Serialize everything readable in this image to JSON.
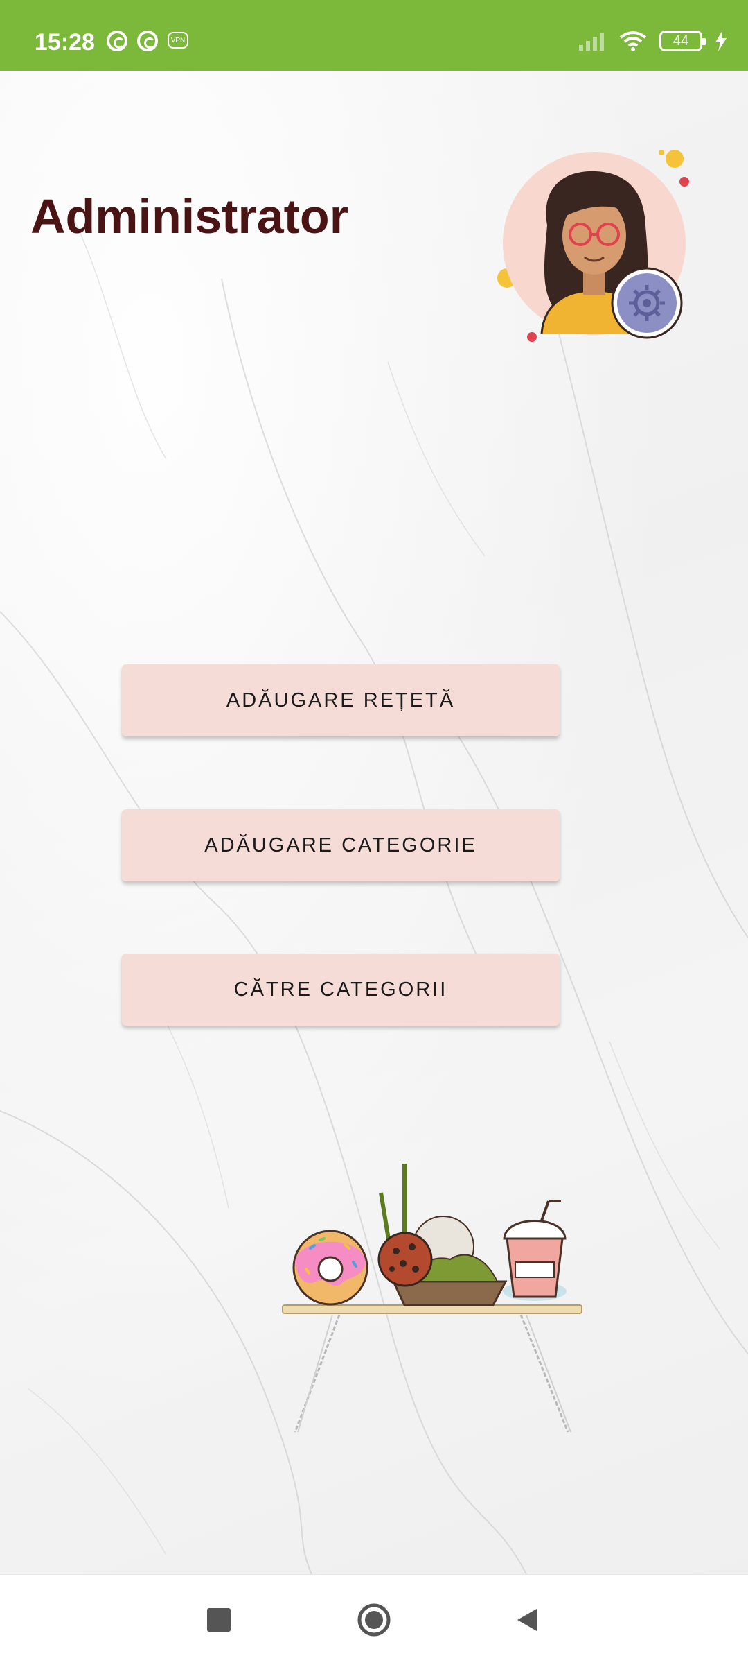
{
  "status_bar": {
    "time": "15:28",
    "battery_level": "44",
    "icons": [
      "sync-icon",
      "sync-icon",
      "vpn-badge-icon",
      "signal-icon",
      "wifi-icon",
      "battery-icon",
      "charging-icon"
    ],
    "background_color": "#7cb83a"
  },
  "header": {
    "title": "Administrator",
    "avatar": "admin-avatar-with-settings-icon"
  },
  "actions": [
    {
      "label": "ADĂUGARE REȚETĂ"
    },
    {
      "label": "ADĂUGARE CATEGORIE"
    },
    {
      "label": "CĂTRE CATEGORII"
    }
  ],
  "illustration": "food-table-illustration",
  "nav_bar": {
    "buttons": [
      "recents-square-icon",
      "home-circle-icon",
      "back-triangle-icon"
    ]
  },
  "colors": {
    "title": "#4a1414",
    "button_background": "#f6dcd6",
    "accent_green": "#7cb83a"
  }
}
